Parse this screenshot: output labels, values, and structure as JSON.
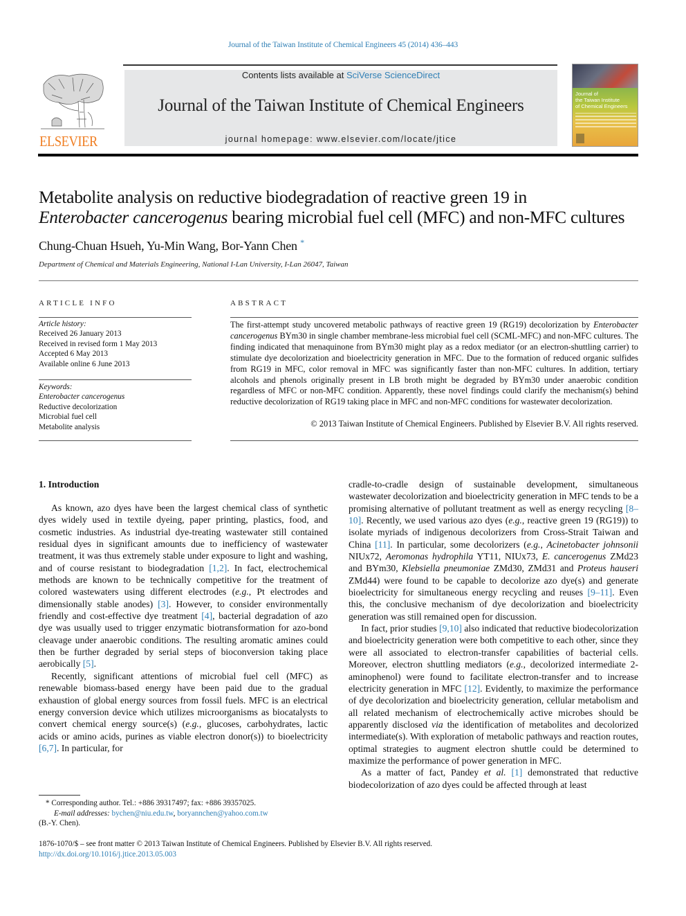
{
  "citation": "Journal of the Taiwan Institute of Chemical Engineers 45 (2014) 436–443",
  "header": {
    "publisher_logo_text": "ELSEVIER",
    "contents_prefix": "Contents lists available at ",
    "contents_link": "SciVerse ScienceDirect",
    "journal_title": "Journal of the Taiwan Institute of Chemical Engineers",
    "homepage_prefix": "journal homepage: ",
    "homepage_url": "www.elsevier.com/locate/jtice",
    "cover_title_lines": [
      "Journal of",
      "the Taiwan Institute",
      "of Chemical Engineers"
    ],
    "colors": {
      "elsevier_orange": "#f07e22",
      "link_blue": "#2f7fb5",
      "header_grey": "#e6e7e8"
    }
  },
  "article": {
    "title_line1": "Metabolite analysis on reductive biodegradation of reactive green 19 in",
    "title_line2_italic": "Enterobacter cancerogenus",
    "title_line2_rest": " bearing microbial fuel cell (MFC) and non-MFC cultures",
    "authors": "Chung-Chuan Hsueh, Yu-Min Wang, Bor-Yann Chen",
    "corresponding_marker": "*",
    "affiliation": "Department of Chemical and Materials Engineering, National I-Lan University, I-Lan 26047, Taiwan"
  },
  "article_info": {
    "heading": "ARTICLE INFO",
    "history_label": "Article history:",
    "history": [
      "Received 26 January 2013",
      "Received in revised form 1 May 2013",
      "Accepted 6 May 2013",
      "Available online 6 June 2013"
    ],
    "keywords_label": "Keywords:",
    "keywords": [
      "Enterobacter cancerogenus",
      "Reductive decolorization",
      "Microbial fuel cell",
      "Metabolite analysis"
    ]
  },
  "abstract": {
    "heading": "ABSTRACT",
    "p1": "The first-attempt study uncovered metabolic pathways of reactive green 19 (RG19) decolorization by ",
    "species": "Enterobacter cancerogenus",
    "p2": " BYm30 in single chamber membrane-less microbial fuel cell (SCML-MFC) and non-MFC cultures. The finding indicated that menaquinone from BYm30 might play as a redox mediator (or an electron-shuttling carrier) to stimulate dye decolorization and bioelectricity generation in MFC. Due to the formation of reduced organic sulfides from RG19 in MFC, color removal in MFC was significantly faster than non-MFC cultures. In addition, tertiary alcohols and phenols originally present in LB broth might be degraded by BYm30 under anaerobic condition regardless of MFC or non-MFC condition. Apparently, these novel findings could clarify the mechanism(s) behind reductive decolorization of RG19 taking place in MFC and non-MFC conditions for wastewater decolorization.",
    "copyright": "© 2013 Taiwan Institute of Chemical Engineers. Published by Elsevier B.V. All rights reserved."
  },
  "body": {
    "section1_heading": "1.  Introduction",
    "left": {
      "p1_a": "As known, azo dyes have been the largest chemical class of synthetic dyes widely used in textile dyeing, paper printing, plastics, food, and cosmetic industries. As industrial dye-treating wastewater still contained residual dyes in significant amounts due to inefficiency of wastewater treatment, it was thus extremely stable under exposure to light and washing, and of course resistant to biodegradation ",
      "ref_1_2": "[1,2]",
      "p1_b": ". In fact, electrochemical methods are known to be technically competitive for the treatment of colored wastewaters using different electrodes (",
      "eg1": "e.g.",
      "p1_c": ", Pt electrodes and dimensionally stable anodes) ",
      "ref_3": "[3]",
      "p1_d": ". However, to consider environmentally friendly and cost-effective dye treatment ",
      "ref_4": "[4]",
      "p1_e": ", bacterial degradation of azo dye was usually used to trigger enzymatic biotransformation for azo-bond cleavage under anaerobic conditions. The resulting aromatic amines could then be further degraded by serial steps of bioconversion taking place aerobically ",
      "ref_5": "[5]",
      "p1_f": ".",
      "p2_a": "Recently, significant attentions of microbial fuel cell (MFC) as renewable biomass-based energy have been paid due to the gradual exhaustion of global energy sources from fossil fuels. MFC is an electrical energy conversion device which utilizes microorganisms as biocatalysts to convert chemical energy source(s) (",
      "eg2": "e.g.",
      "p2_b": ", glucoses, carbohydrates, lactic acids or amino acids, purines as viable electron donor(s)) to bioelectricity ",
      "ref_6_7": "[6,7]",
      "p2_c": ". In particular, for"
    },
    "right": {
      "p1_a": "cradle-to-cradle design of sustainable development, simultaneous wastewater decolorization and bioelectricity generation in MFC tends to be a promising alternative of pollutant treatment as well as energy recycling ",
      "ref_8_10": "[8–10]",
      "p1_b": ". Recently, we used various azo dyes (",
      "eg1": "e.g.",
      "p1_c": ", reactive green 19 (RG19)) to isolate myriads of indigenous decolorizers from Cross-Strait Taiwan and China ",
      "ref_11": "[11]",
      "p1_d": ". In particular, some decolorizers (",
      "eg2": "e.g.",
      "p1_e": ", ",
      "sp1": "Acinetobacter johnsonii",
      "p1_f": " NIUx72, ",
      "sp2": "Aeromonas hydrophila",
      "p1_g": " YT11, NIUx73, ",
      "sp3": "E. cancerogenus",
      "p1_h": " ZMd23 and BYm30, ",
      "sp4": "Klebsiella pneumoniae",
      "p1_i": " ZMd30, ZMd31 and ",
      "sp5": "Proteus hauseri",
      "p1_j": " ZMd44) were found to be capable to decolorize azo dye(s) and generate bioelectricity for simultaneous energy recycling and reuses ",
      "ref_9_11": "[9–11]",
      "p1_k": ". Even this, the conclusive mechanism of dye decolorization and bioelectricity generation was still remained open for discussion.",
      "p2_a": "In fact, prior studies ",
      "ref_9_10": "[9,10]",
      "p2_b": " also indicated that reductive biodecolorization and bioelectricity generation were both competitive to each other, since they were all associated to electron-transfer capabilities of bacterial cells. Moreover, electron shuttling mediators (",
      "eg3": "e.g.",
      "p2_c": ", decolorized intermediate 2-aminophenol) were found to facilitate electron-transfer and to increase electricity generation in MFC ",
      "ref_12": "[12]",
      "p2_d": ". Evidently, to maximize the performance of dye decolorization and bioelectricity generation, cellular metabolism and all related mechanism of electrochemically active microbes should be apparently disclosed ",
      "via": "via",
      "p2_e": " the identification of metabolites and decolorized intermediate(s). With exploration of metabolic pathways and reaction routes, optimal strategies to augment electron shuttle could be determined to maximize the performance of power generation in MFC.",
      "p3_a": "As a matter of fact, Pandey ",
      "etal": "et al.",
      "p3_b": " ",
      "ref_1": "[1]",
      "p3_c": " demonstrated that reductive biodecolorization of azo dyes could be affected through at least"
    }
  },
  "footnote": {
    "marker": "*",
    "corresponding": " Corresponding author. Tel.: +886 39317497; fax: +886 39357025.",
    "email_label": "E-mail addresses:",
    "email1": "bychen@niu.edu.tw",
    "email_sep": ", ",
    "email2": "boryannchen@yahoo.com.tw",
    "name": "(B.-Y. Chen)."
  },
  "front_matter": {
    "issn_line": "1876-1070/$ – see front matter © 2013 Taiwan Institute of Chemical Engineers. Published by Elsevier B.V. All rights reserved.",
    "doi": "http://dx.doi.org/10.1016/j.jtice.2013.05.003"
  }
}
